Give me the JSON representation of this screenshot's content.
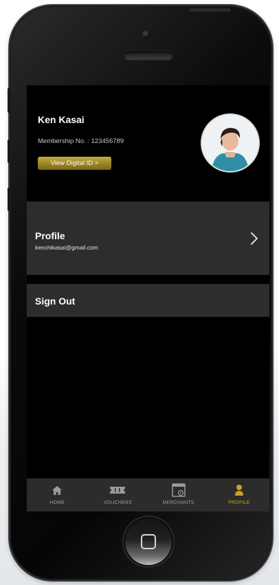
{
  "profile_header": {
    "name": "Ken Kasai",
    "membership": "Membership No. : 123456789",
    "digital_id_button": "View Digital ID >"
  },
  "menu": {
    "profile_title": "Profile",
    "profile_email": "kenchikasai@gmail.com",
    "sign_out": "Sign Out"
  },
  "tabs": [
    {
      "label": "HOME",
      "icon": "home-icon",
      "active": false
    },
    {
      "label": "VOUCHERS",
      "icon": "ticket-icon",
      "active": false
    },
    {
      "label": "MERCHANTS",
      "icon": "store-icon",
      "active": false
    },
    {
      "label": "PROFILE",
      "icon": "user-icon",
      "active": true
    }
  ],
  "colors": {
    "accent": "#c9a227",
    "tab_inactive": "#9b9b9b",
    "card_bg": "#2d2d2d",
    "screen_bg": "#000000"
  }
}
